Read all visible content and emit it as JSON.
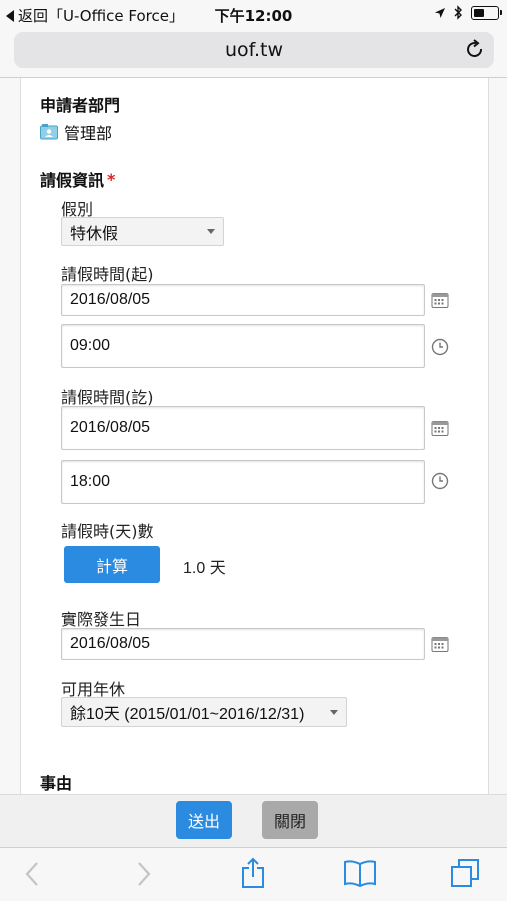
{
  "status_bar": {
    "back_app": "返回「U-Office Force」",
    "time": "下午12:00",
    "battery_level": 0.45
  },
  "browser": {
    "url": "uof.tw"
  },
  "form": {
    "applicant_dept_label": "申請者部門",
    "applicant_dept_value": "管理部",
    "leave_info_label": "請假資訊",
    "required_mark": "*",
    "leave_type_label": "假別",
    "leave_type_value": "特休假",
    "start_label": "請假時間(起)",
    "start_date": "2016/08/05",
    "start_time": "09:00",
    "end_label": "請假時間(訖)",
    "end_date": "2016/08/05",
    "end_time": "18:00",
    "days_label": "請假時(天)數",
    "calc_button": "計算",
    "days_value": "1.0 天",
    "actual_date_label": "實際發生日",
    "actual_date": "2016/08/05",
    "annual_leave_label": "可用年休",
    "annual_leave_value": "餘10天 (2015/01/01~2016/12/31)",
    "reason_label": "事由"
  },
  "actions": {
    "send": "送出",
    "close": "關閉"
  },
  "icons": {
    "calendar": "calendar-icon",
    "clock": "clock-icon",
    "dept": "department-card-icon",
    "reload": "reload-icon",
    "back": "back-arrow-icon",
    "forward": "forward-arrow-icon",
    "share": "share-icon",
    "bookmarks": "bookmarks-icon",
    "tabs": "tabs-icon"
  },
  "colors": {
    "accent": "#2a8be0",
    "required": "#e02020",
    "close_button": "#a9a9a9"
  }
}
